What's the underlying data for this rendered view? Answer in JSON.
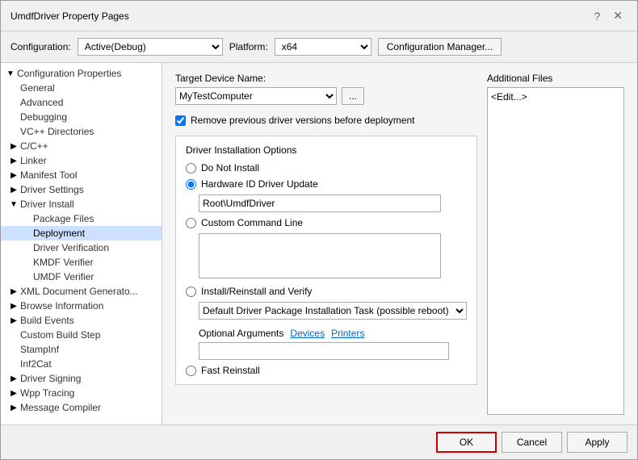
{
  "window": {
    "title": "UmdfDriver Property Pages",
    "help_btn": "?",
    "close_btn": "✕"
  },
  "toolbar": {
    "config_label": "Configuration:",
    "config_value": "Active(Debug)",
    "platform_label": "Platform:",
    "platform_value": "x64",
    "config_manager_label": "Configuration Manager..."
  },
  "tree": {
    "root": "Configuration Properties",
    "items": [
      {
        "id": "general",
        "label": "General",
        "level": 1,
        "expandable": false,
        "expanded": false
      },
      {
        "id": "advanced",
        "label": "Advanced",
        "level": 1,
        "expandable": false,
        "expanded": false
      },
      {
        "id": "debugging",
        "label": "Debugging",
        "level": 1,
        "expandable": false,
        "expanded": false
      },
      {
        "id": "vc-dirs",
        "label": "VC++ Directories",
        "level": 1,
        "expandable": false,
        "expanded": false
      },
      {
        "id": "cpp",
        "label": "C/C++",
        "level": 1,
        "expandable": true,
        "expanded": false
      },
      {
        "id": "linker",
        "label": "Linker",
        "level": 1,
        "expandable": true,
        "expanded": false
      },
      {
        "id": "manifest-tool",
        "label": "Manifest Tool",
        "level": 1,
        "expandable": true,
        "expanded": false
      },
      {
        "id": "driver-settings",
        "label": "Driver Settings",
        "level": 1,
        "expandable": true,
        "expanded": false
      },
      {
        "id": "driver-install",
        "label": "Driver Install",
        "level": 1,
        "expandable": true,
        "expanded": true
      },
      {
        "id": "package-files",
        "label": "Package Files",
        "level": 2,
        "expandable": false,
        "expanded": false
      },
      {
        "id": "deployment",
        "label": "Deployment",
        "level": 2,
        "expandable": false,
        "expanded": false,
        "selected": true
      },
      {
        "id": "driver-verification",
        "label": "Driver Verification",
        "level": 2,
        "expandable": false,
        "expanded": false
      },
      {
        "id": "kmdf-verifier",
        "label": "KMDF Verifier",
        "level": 2,
        "expandable": false,
        "expanded": false
      },
      {
        "id": "umdf-verifier",
        "label": "UMDF Verifier",
        "level": 2,
        "expandable": false,
        "expanded": false
      },
      {
        "id": "xml-doc",
        "label": "XML Document Generato...",
        "level": 1,
        "expandable": true,
        "expanded": false
      },
      {
        "id": "browse-info",
        "label": "Browse Information",
        "level": 1,
        "expandable": true,
        "expanded": false
      },
      {
        "id": "build-events",
        "label": "Build Events",
        "level": 1,
        "expandable": true,
        "expanded": false
      },
      {
        "id": "custom-build",
        "label": "Custom Build Step",
        "level": 1,
        "expandable": false,
        "expanded": false
      },
      {
        "id": "stampinf",
        "label": "StampInf",
        "level": 1,
        "expandable": false,
        "expanded": false
      },
      {
        "id": "inf2cat",
        "label": "Inf2Cat",
        "level": 1,
        "expandable": false,
        "expanded": false
      },
      {
        "id": "driver-signing",
        "label": "Driver Signing",
        "level": 1,
        "expandable": true,
        "expanded": false
      },
      {
        "id": "wpp-tracing",
        "label": "Wpp Tracing",
        "level": 1,
        "expandable": true,
        "expanded": false
      },
      {
        "id": "message-compiler",
        "label": "Message Compiler",
        "level": 1,
        "expandable": true,
        "expanded": false
      }
    ]
  },
  "content": {
    "target_device_label": "Target Device Name:",
    "target_device_value": "MyTestComputer",
    "remove_checkbox_label": "Remove previous driver versions before deployment",
    "remove_checkbox_checked": true,
    "driver_install_label": "Driver Installation Options",
    "radio_do_not_install": "Do Not Install",
    "radio_hw_driver": "Hardware ID Driver Update",
    "hw_driver_value": "Root\\UmdfDriver",
    "radio_custom_cmd": "Custom Command Line",
    "custom_cmd_placeholder": "",
    "radio_install_reinstall": "Install/Reinstall and Verify",
    "install_reinstall_value": "Default Driver Package Installation Task (possible reboot)",
    "optional_args_label": "Optional Arguments",
    "optional_devices_link": "Devices",
    "optional_printers_link": "Printers",
    "optional_args_value": "",
    "radio_fast_reinstall": "Fast Reinstall",
    "additional_files_label": "Additional Files",
    "additional_files_edit": "<Edit...>"
  },
  "buttons": {
    "ok": "OK",
    "cancel": "Cancel",
    "apply": "Apply"
  }
}
